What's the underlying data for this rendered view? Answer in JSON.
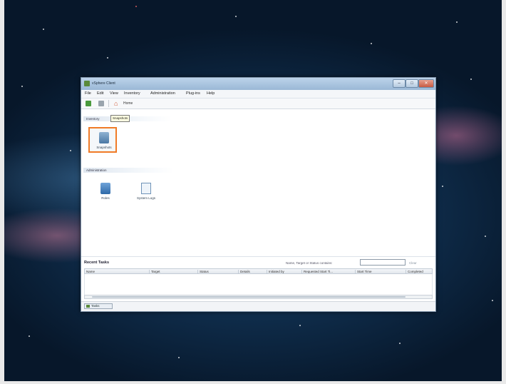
{
  "window": {
    "title": "vSphere Client"
  },
  "menu": [
    "File",
    "Edit",
    "View",
    "Inventory",
    "Administration",
    "Plug-ins",
    "Help"
  ],
  "toolbar": {
    "home_label": "Home"
  },
  "sections": {
    "inventory": {
      "label": "Inventory",
      "tooltip": "Snapshots"
    },
    "administration": {
      "label": "Administration"
    }
  },
  "launchers": {
    "snapshots": "Snapshots",
    "roles": "Roles",
    "session_logs": "System Logs"
  },
  "tasks": {
    "title": "Recent Tasks",
    "filter_label": "Name, Target or Status contains:",
    "filter_value": "",
    "clear_label": "Clear",
    "columns": [
      "Name",
      "Target",
      "Status",
      "Details",
      "Initiated by",
      "Requested Start Ti...",
      "Start Time",
      "Completed"
    ]
  },
  "status": {
    "tasks_tab": "Tasks"
  },
  "colors": {
    "highlight": "#f07b27",
    "titlebar": "#9ab8d6"
  }
}
